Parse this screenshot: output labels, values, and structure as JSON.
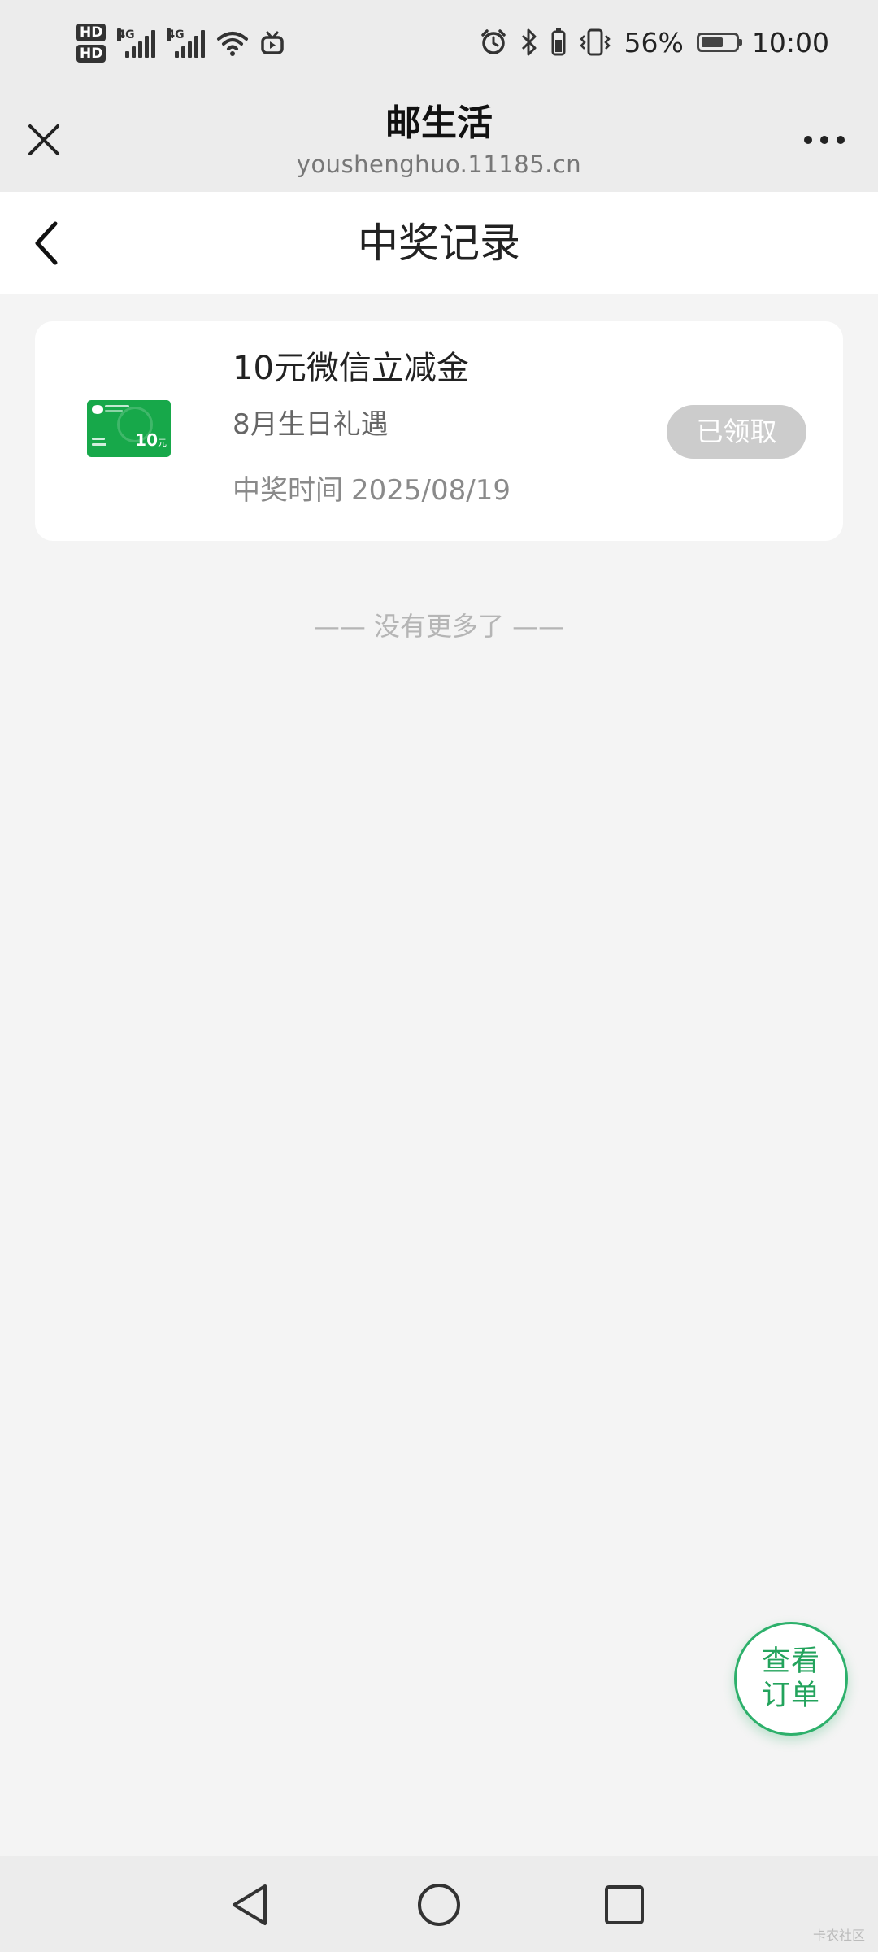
{
  "status_bar": {
    "network_1": "4G",
    "network_2": "4G",
    "hd_1": "HD",
    "hd_2": "HD",
    "battery_percent": "56%",
    "time": "10:00"
  },
  "browser": {
    "title": "邮生活",
    "url": "youshenghuo.11185.cn"
  },
  "page": {
    "title": "中奖记录"
  },
  "prizes": [
    {
      "title": "10元微信立减金",
      "subtitle": "8月生日礼遇",
      "time_label": "中奖时间",
      "time_value": "2025/08/19",
      "status": "已领取",
      "thumb_amount": "10",
      "thumb_unit": "元"
    }
  ],
  "list_end": "—— 没有更多了 ——",
  "fab": {
    "line1": "查看",
    "line2": "订单",
    "accent": "#2db06b"
  },
  "watermark": "卡农社区"
}
